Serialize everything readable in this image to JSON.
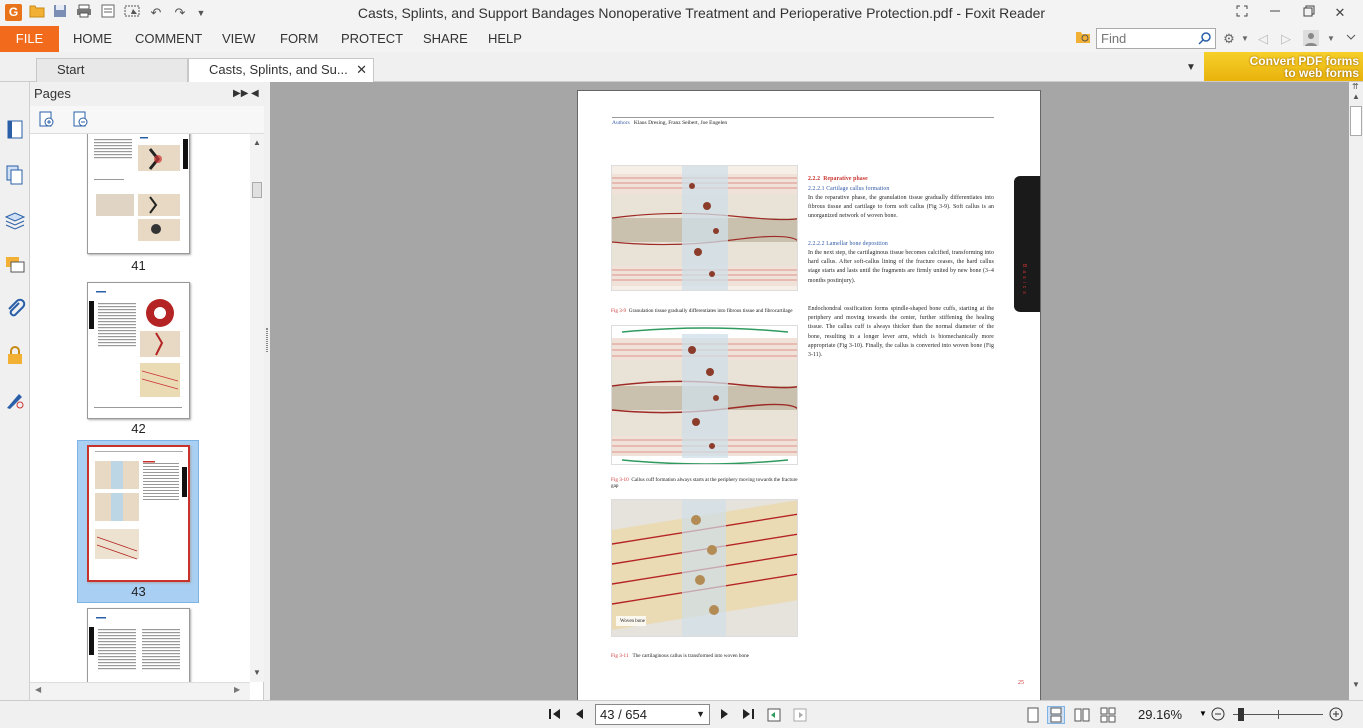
{
  "window": {
    "title": "Casts, Splints, and Support Bandages Nonoperative Treatment and Perioperative Protection.pdf - Foxit Reader",
    "app_logo": "G"
  },
  "menu": {
    "file": "FILE",
    "items": [
      "HOME",
      "COMMENT",
      "VIEW",
      "FORM",
      "PROTECT",
      "SHARE",
      "HELP"
    ],
    "find_placeholder": "Find"
  },
  "tabs": [
    {
      "label": "Start"
    },
    {
      "label": "Casts, Splints, and Su...",
      "close": "✕"
    }
  ],
  "banner": {
    "line1": "Convert PDF forms",
    "line2": "to web forms"
  },
  "pages_panel": {
    "title": "Pages",
    "thumbnails": [
      {
        "label": "41"
      },
      {
        "label": "42"
      },
      {
        "label": "43"
      }
    ]
  },
  "document_page": {
    "authors_label": "Authors",
    "authors": "Klaus Dresing, Franz Seibert, Joe Engelen",
    "section_num": "2.2.2",
    "section_title": "Reparative phase",
    "sub1_title": "2.2.2.1 Cartilage callus formation",
    "sub1_text": "In the reparative phase, the granulation tissue gradually differentiates into fibrous tissue and cartilage to form soft callus (Fig 3-9). Soft callus is an unorganized network of woven bone.",
    "sub2_title": "2.2.2.2 Lamellar bone deposition",
    "sub2_text": "In the next step, the cartilaginous tissue becomes calcified, transforming into hard callus. After soft-callus lining of the fracture ceases, the hard callus stage starts and lasts until the fragments are firmly united by new bone (3–4 months postinjury).",
    "para3": "Endochondral ossification forms spindle-shaped bone cuffs, starting at the periphery and moving towards the center, further stiffening the healing tissue. The callus cuff is always thicker than the normal diameter of the bone, resulting in a longer lever arm, which is biomechanically more appropriate (Fig 3-10). Finally, the callus is converted into woven bone (Fig 3-11).",
    "fig9_label": "Fig 3-9",
    "fig9_caption": "Granulation tissue gradually differentiates into fibrous tissue and fibrocartilage",
    "fig10_label": "Fig 3-10",
    "fig10_caption": "Callus cuff formation always starts at the periphery moving towards the fracture gap",
    "fig11_label": "Fig 3-11",
    "fig11_caption": "The cartilaginous callus is transformed into woven bone",
    "fig11_inset": "Woven bone",
    "page_number": "25",
    "side_tab": "Basics"
  },
  "status": {
    "page_field": "43 / 654",
    "zoom": "29.16%"
  }
}
